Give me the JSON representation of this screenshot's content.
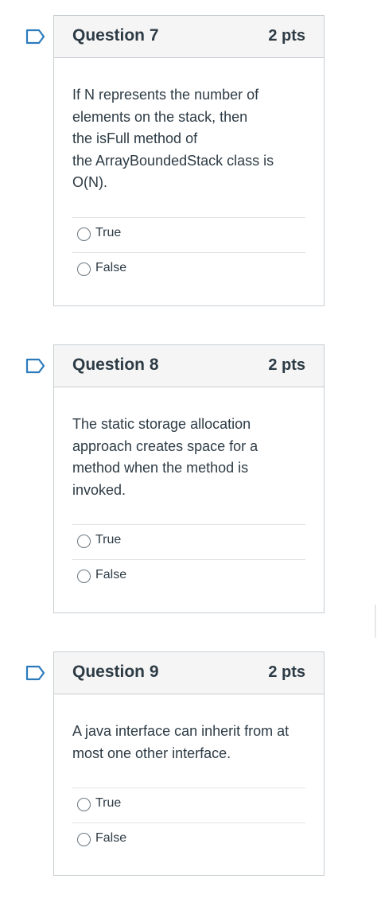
{
  "questions": [
    {
      "title": "Question 7",
      "points": "2 pts",
      "text": "If N represents the number of elements on the stack, then the isFull method of the ArrayBoundedStack class is O(N).",
      "text_lines": [
        "If N represents the number of",
        "elements on the stack, then",
        "the isFull method of",
        "the ArrayBoundedStack class is",
        "O(N)."
      ],
      "options": [
        "True",
        "False"
      ]
    },
    {
      "title": "Question 8",
      "points": "2 pts",
      "text": "The static storage allocation approach creates space for a method when the method is invoked.",
      "text_lines": [
        "The static storage allocation",
        "approach creates space for a",
        "method when the method is",
        "invoked."
      ],
      "options": [
        "True",
        "False"
      ]
    },
    {
      "title": "Question 9",
      "points": "2 pts",
      "text": "A java interface can inherit from at most one other interface.",
      "text_lines": [
        "A java interface can inherit from at",
        "most one other interface."
      ],
      "options": [
        "True",
        "False"
      ]
    }
  ],
  "icons": {
    "flag": "bookmark-flag-icon",
    "radio": "radio-button-icon"
  },
  "colors": {
    "flag_accent": "#2b7abc",
    "header_bg": "#f5f5f5",
    "border": "#c7cdd1",
    "text": "#2d3b45"
  }
}
